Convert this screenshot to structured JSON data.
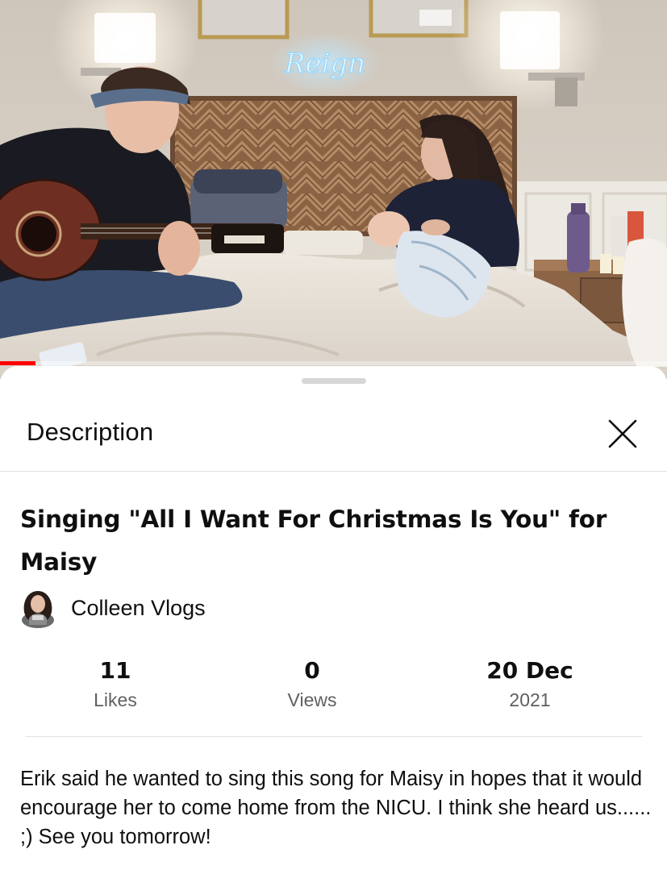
{
  "video": {
    "neon_sign_text": "Reign"
  },
  "sheet": {
    "title": "Description",
    "video_title": "Singing \"All I Want For Christmas Is You\" for Maisy",
    "channel": {
      "name": "Colleen Vlogs"
    },
    "stats": {
      "likes_value": "11",
      "likes_label": "Likes",
      "views_value": "0",
      "views_label": "Views",
      "date_value": "20 Dec",
      "year_label": "2021"
    },
    "description": "Erik said he wanted to sing this song for Maisy in hopes that it would encourage her to come home from the NICU. I think she heard us...... ;) See you tomorrow!"
  },
  "icons": {
    "close": "close-icon",
    "avatar": "channel-avatar"
  },
  "colors": {
    "text_primary": "#0f0f0f",
    "text_secondary": "#606060",
    "divider": "#e2e2e2",
    "progress_red": "#ff0000"
  }
}
